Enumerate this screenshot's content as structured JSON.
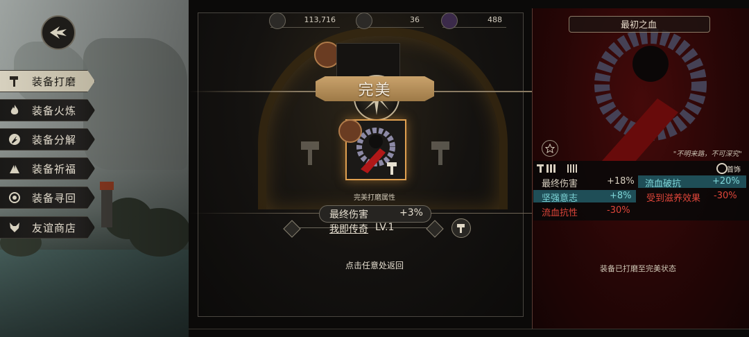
{
  "menu": {
    "items": [
      {
        "label": "装备打磨",
        "icon": "hammer-icon",
        "active": true
      },
      {
        "label": "装备火炼",
        "icon": "flame-icon",
        "active": false
      },
      {
        "label": "装备分解",
        "icon": "disassemble-icon",
        "active": false
      },
      {
        "label": "装备祈福",
        "icon": "pray-icon",
        "active": false
      },
      {
        "label": "装备寻回",
        "icon": "retrieve-icon",
        "active": false
      },
      {
        "label": "友谊商店",
        "icon": "fox-icon",
        "active": false
      }
    ]
  },
  "currency": {
    "gears": "113,716",
    "ore": "36",
    "crystal": "488"
  },
  "dialog": {
    "title": "完美",
    "attr_title": "完美打磨属性",
    "stat_name": "最终伤害",
    "stat_value": "+3%",
    "legend_name": "我即传奇",
    "legend_level": "LV.1",
    "return_hint": "点击任意处返回"
  },
  "item_panel": {
    "name": "最初之血",
    "flavor": "\"不明来路，不可深究\"",
    "accessory_label": "首饰",
    "stats": [
      {
        "name": "最终伤害",
        "value": "+18%"
      },
      {
        "name": "流血破抗",
        "value": "+20%"
      },
      {
        "name": "坚强意志",
        "value": "+8%"
      },
      {
        "name": "受到滋养效果",
        "value": "-30%"
      },
      {
        "name": "流血抗性",
        "value": "-30%"
      }
    ],
    "status": "装备已打磨至完美状态"
  },
  "colors": {
    "accent_gold": "#c9a26b",
    "highlight_teal": "#1f4e57",
    "negative_red": "#e0463a",
    "teal_text": "#7fd6d8"
  }
}
